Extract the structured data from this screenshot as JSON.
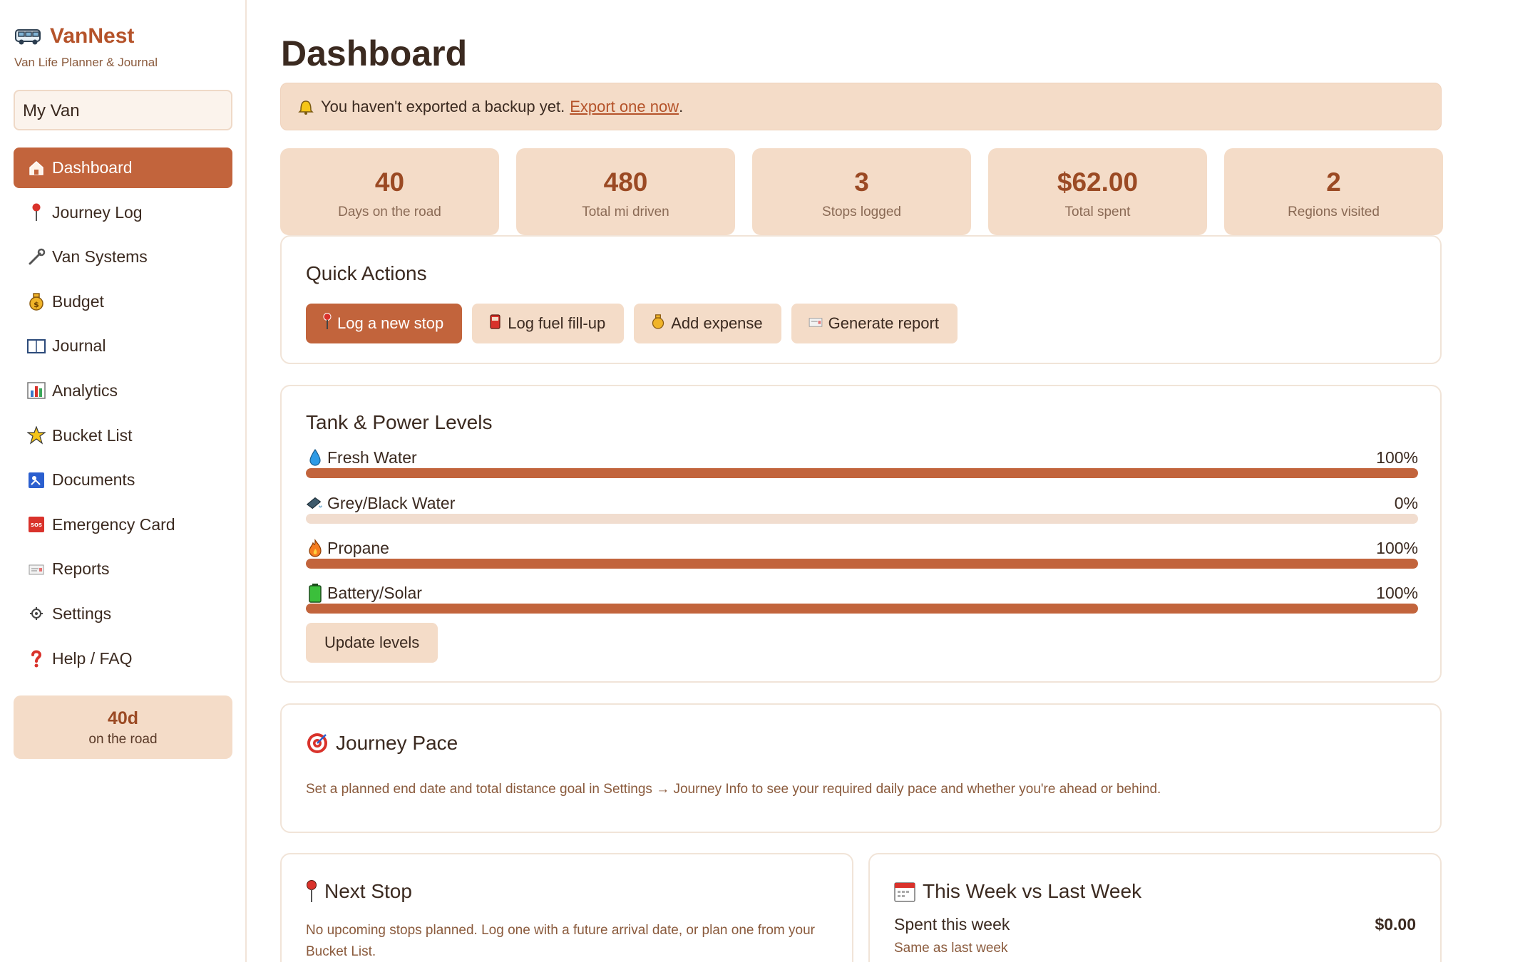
{
  "app": {
    "name": "VanNest",
    "subtitle": "Van Life Planner & Journal"
  },
  "sidebar": {
    "van_selector": "My Van",
    "items": [
      {
        "label": "Dashboard",
        "icon": "house-icon",
        "active": true
      },
      {
        "label": "Journey Log",
        "icon": "pin-icon"
      },
      {
        "label": "Van Systems",
        "icon": "wrench-icon"
      },
      {
        "label": "Budget",
        "icon": "money-bag-icon"
      },
      {
        "label": "Journal",
        "icon": "book-icon"
      },
      {
        "label": "Analytics",
        "icon": "bar-chart-icon"
      },
      {
        "label": "Bucket List",
        "icon": "sparkle-icon"
      },
      {
        "label": "Documents",
        "icon": "passport-icon"
      },
      {
        "label": "Emergency Card",
        "icon": "sos-icon"
      },
      {
        "label": "Reports",
        "icon": "report-icon"
      },
      {
        "label": "Settings",
        "icon": "gear-icon"
      },
      {
        "label": "Help / FAQ",
        "icon": "question-icon"
      }
    ],
    "road_card": {
      "value": "40d",
      "label": "on the road"
    }
  },
  "main": {
    "title": "Dashboard",
    "banner": {
      "text": "You haven't exported a backup yet.",
      "link": "Export one now",
      "suffix": "."
    },
    "stats": [
      {
        "value": "40",
        "label": "Days on the road"
      },
      {
        "value": "480",
        "label": "Total mi driven"
      },
      {
        "value": "3",
        "label": "Stops logged"
      },
      {
        "value": "$62.00",
        "label": "Total spent"
      },
      {
        "value": "2",
        "label": "Regions visited"
      }
    ],
    "quick_actions": {
      "title": "Quick Actions",
      "buttons": [
        {
          "label": "Log a new stop",
          "icon": "pin-icon"
        },
        {
          "label": "Log fuel fill-up",
          "icon": "fuel-icon"
        },
        {
          "label": "Add expense",
          "icon": "money-bag-icon"
        },
        {
          "label": "Generate report",
          "icon": "report-icon"
        }
      ]
    },
    "tanks": {
      "title": "Tank & Power Levels",
      "levels": [
        {
          "name": "Fresh Water",
          "percent_text": "100%",
          "fraction": 1.0,
          "icon": "droplet-icon"
        },
        {
          "name": "Grey/Black Water",
          "percent_text": "0%",
          "fraction": 0.0,
          "icon": "grey-water-icon"
        },
        {
          "name": "Propane",
          "percent_text": "100%",
          "fraction": 1.0,
          "icon": "flame-icon"
        },
        {
          "name": "Battery/Solar",
          "percent_text": "100%",
          "fraction": 1.0,
          "icon": "battery-icon"
        }
      ],
      "update_button": "Update levels"
    },
    "pace": {
      "title": "Journey Pace",
      "text": "Set a planned end date and total distance goal in Settings → Journey Info to see your required daily pace and whether you're ahead or behind."
    },
    "next_stop": {
      "title": "Next Stop",
      "text": "No upcoming stops planned. Log one with a future arrival date, or plan one from your Bucket List."
    },
    "week": {
      "title": "This Week vs Last Week",
      "spent_label": "Spent this week",
      "spent_value": "$0.00",
      "compare": "Same as last week"
    }
  },
  "colors": {
    "accent": "#c2643c",
    "accent_dark": "#9b4a24",
    "soft": "#f4dcc8",
    "border": "#f1e4d8"
  }
}
